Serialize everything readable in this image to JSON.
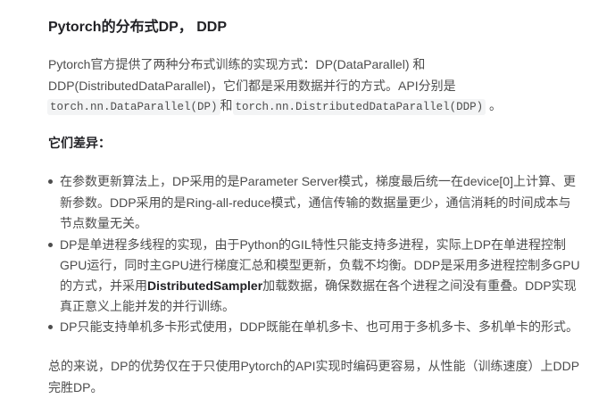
{
  "title": "Pytorch的分布式DP， DDP",
  "intro": {
    "line1": "Pytorch官方提供了两种分布式训练的实现方式：DP(DataParallel) 和",
    "line2": "DDP(DistributedDataParallel)，它们都是采用数据并行的方式。API分别是",
    "code1": "torch.nn.DataParallel(DP)",
    "joiner": "和",
    "code2": "torch.nn.DistributedDataParallel(DDP)",
    "end": " 。"
  },
  "diff_heading": "它们差异：",
  "bullets": [
    {
      "lines": [
        "在参数更新算法上，DP采用的是Parameter Server模式，梯度最后统一在device[0]上计算、更",
        "新参数。DDP采用的是Ring-all-reduce模式，通信传输的数据量更少，通信消耗的时间成本与",
        "节点数量无关。"
      ]
    },
    {
      "lines": [
        "DP是单进程多线程的实现，由于Python的GIL特性只能支持多进程，实际上DP在单进程控制",
        "GPU运行，同时主GPU进行梯度汇总和模型更新，负载不均衡。DDP是采用多进程控制多GPU"
      ],
      "line3_pre": "的方式，并采用",
      "line3_bold": "DistributedSampler",
      "line3_post": "加载数据，确保数据在各个进程之间没有重叠。DDP实现",
      "line4": "真正意义上能并发的并行训练。"
    },
    {
      "lines": [
        "DP只能支持单机多卡形式使用，DDP既能在单机多卡、也可用于多机多卡、多机单卡的形式。"
      ]
    }
  ],
  "summary": [
    "总的来说，DP的优势仅在于只使用Pytorch的API实现时编码更容易，从性能（训练速度）上DDP",
    "完胜DP。"
  ]
}
